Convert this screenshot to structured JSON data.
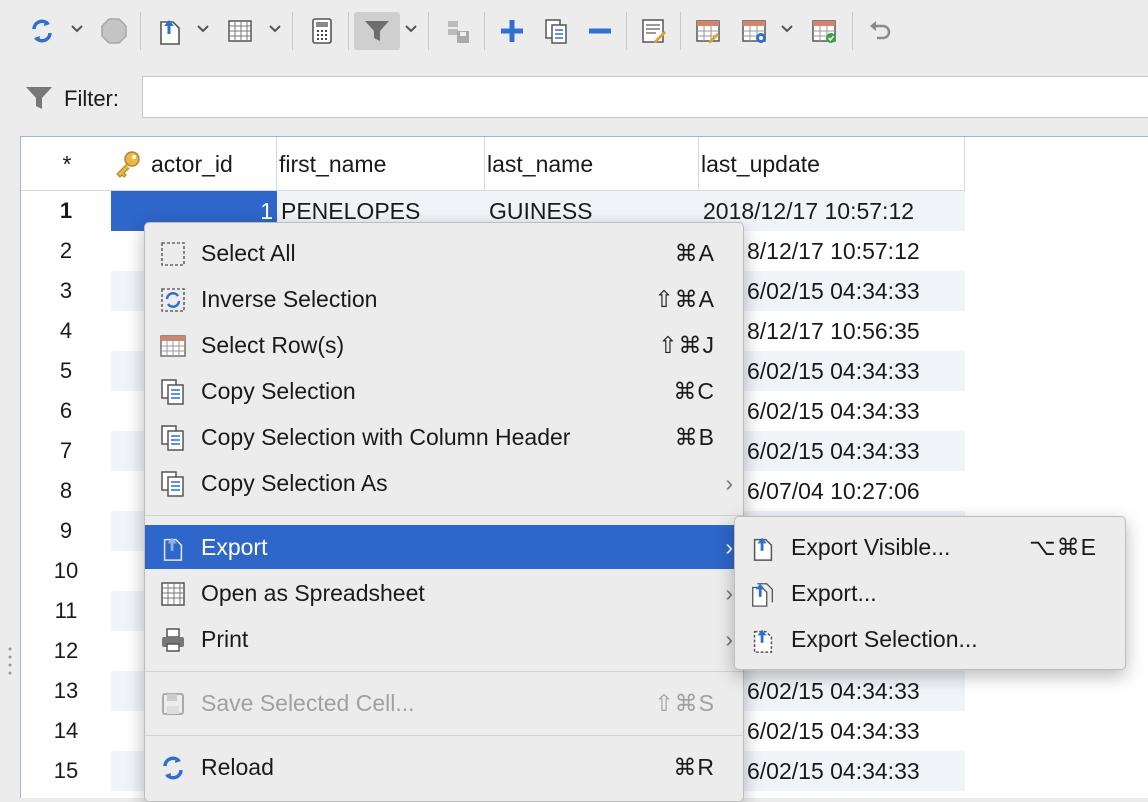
{
  "toolbar": {
    "icons": [
      "refresh-icon",
      "stop-icon",
      "export-icon",
      "spreadsheet-icon",
      "calculator-icon",
      "filter-icon",
      "save-icon",
      "add-row-icon",
      "duplicate-row-icon",
      "remove-row-icon",
      "edit-record-icon",
      "grid-edit-icon",
      "grid-settings-icon",
      "grid-check-icon",
      "undo-icon"
    ]
  },
  "filter": {
    "label": "Filter:",
    "value": ""
  },
  "grid": {
    "corner": "*",
    "columns": [
      "actor_id",
      "first_name",
      "last_name",
      "last_update"
    ],
    "row_numbers": [
      "1",
      "2",
      "3",
      "4",
      "5",
      "6",
      "7",
      "8",
      "9",
      "10",
      "11",
      "12",
      "13",
      "14",
      "15"
    ],
    "row1": {
      "actor_id": "1",
      "first_name": "PENELOPES",
      "last_name": "GUINESS",
      "last_update": "2018/12/17 10:57:12"
    },
    "last_update_visible": [
      "8/12/17 10:57:12",
      "6/02/15 04:34:33",
      "8/12/17 10:56:35",
      "6/02/15 04:34:33",
      "6/02/15 04:34:33",
      "6/02/15 04:34:33",
      "6/07/04 10:27:06",
      "",
      "",
      "",
      "6/02/15 04:34:33",
      "6/02/15 04:34:33",
      "6/02/15 04:34:33"
    ]
  },
  "context_menu": {
    "items": [
      {
        "label": "Select All",
        "shortcut": "⌘A"
      },
      {
        "label": "Inverse Selection",
        "shortcut": "⇧⌘A"
      },
      {
        "label": "Select Row(s)",
        "shortcut": "⇧⌘J"
      },
      {
        "label": "Copy Selection",
        "shortcut": "⌘C"
      },
      {
        "label": "Copy Selection with Column Header",
        "shortcut": "⌘B"
      },
      {
        "label": "Copy Selection As",
        "shortcut": ""
      },
      {
        "label": "Export",
        "shortcut": ""
      },
      {
        "label": "Open as Spreadsheet",
        "shortcut": ""
      },
      {
        "label": "Print",
        "shortcut": ""
      },
      {
        "label": "Save Selected Cell...",
        "shortcut": "⇧⌘S"
      },
      {
        "label": "Reload",
        "shortcut": "⌘R"
      }
    ],
    "submenu_arrow": "›"
  },
  "export_submenu": {
    "items": [
      {
        "label": "Export Visible...",
        "shortcut": "⌥⌘E"
      },
      {
        "label": "Export...",
        "shortcut": ""
      },
      {
        "label": "Export Selection...",
        "shortcut": ""
      }
    ]
  },
  "colors": {
    "accent": "#2e66c9",
    "icon_blue": "#2f6fd0",
    "alt_row": "#f0f4f9"
  }
}
